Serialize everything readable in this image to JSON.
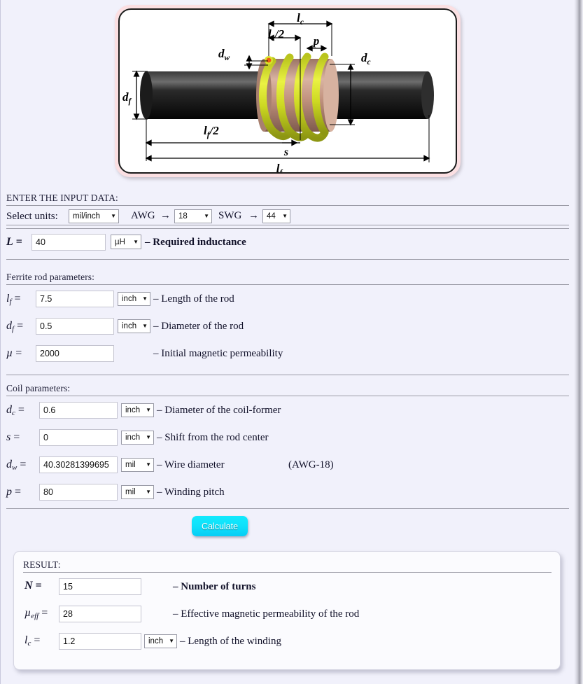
{
  "diagram": {
    "alt": "Ferrite rod inductor cross-section diagram",
    "labels": {
      "lc": "l",
      "lc_sub": "c",
      "lc_half": "l",
      "lc_half_sub": "c",
      "lc_half_suffix": "/2",
      "p": "p",
      "dc": "d",
      "dc_sub": "c",
      "dw": "d",
      "dw_sub": "w",
      "df": "d",
      "df_sub": "f",
      "lf_half": "l",
      "lf_half_sub": "f",
      "lf_half_suffix": "/2",
      "s": "s",
      "lf": "l",
      "lf_sub": "f"
    }
  },
  "header": {
    "enter_input": "ENTER THE INPUT DATA:"
  },
  "units_row": {
    "select_units_label": "Select units:",
    "units_value": "mil/inch",
    "awg_label": "AWG",
    "awg_arrow": "→",
    "awg_value": "18",
    "swg_label": "SWG",
    "swg_arrow": "→",
    "swg_value": "44"
  },
  "inductance": {
    "symbol": "L",
    "equals": "=",
    "value": "40",
    "unit": "µH",
    "desc": "– Required inductance"
  },
  "ferrite": {
    "title": "Ferrite rod parameters:",
    "rows": [
      {
        "symbol": "l",
        "sub": "f",
        "equals": "=",
        "value": "7.5",
        "unit": "inch",
        "desc": "– Length of the rod"
      },
      {
        "symbol": "d",
        "sub": "f",
        "equals": "=",
        "value": "0.5",
        "unit": "inch",
        "desc": "– Diameter of the rod"
      },
      {
        "symbol": "µ",
        "sub": "",
        "equals": "=",
        "value": "2000",
        "unit": "",
        "desc": "– Initial magnetic permeability"
      }
    ]
  },
  "coil": {
    "title": "Coil parameters:",
    "rows": [
      {
        "symbol": "d",
        "sub": "c",
        "equals": "=",
        "value": "0.6",
        "unit": "inch",
        "desc": "– Diameter of the coil-former",
        "note": ""
      },
      {
        "symbol": "s",
        "sub": "",
        "equals": "=",
        "value": "0",
        "unit": "inch",
        "desc": "– Shift from the rod center",
        "note": ""
      },
      {
        "symbol": "d",
        "sub": "w",
        "equals": "=",
        "value": "40.30281399695",
        "unit": "mil",
        "desc": "– Wire diameter",
        "note": "(AWG-18)"
      },
      {
        "symbol": "p",
        "sub": "",
        "equals": "=",
        "value": "80",
        "unit": "mil",
        "desc": "– Winding pitch",
        "note": ""
      }
    ]
  },
  "calculate": {
    "label": "Calculate"
  },
  "result": {
    "title": "RESULT:",
    "rows": [
      {
        "symbol": "N",
        "sub": "",
        "equals": "=",
        "value": "15",
        "unit": "",
        "desc": "– Number of turns",
        "bold": true
      },
      {
        "symbol": "µ",
        "sub": "eff",
        "equals": "=",
        "value": "28",
        "unit": "",
        "desc": "– Effective magnetic permeability of the rod",
        "bold": false
      },
      {
        "symbol": "l",
        "sub": "c",
        "equals": "=",
        "value": "1.2",
        "unit": "inch",
        "desc": "– Length of the winding",
        "bold": false
      }
    ]
  },
  "colors": {
    "page_bg": "#f1f1fb",
    "accent_button": "#0fe2fb",
    "frame_pink": "#fbdfe2",
    "coil_yellow": "#d4e02a",
    "former_tan": "#c9a08f",
    "rod_black": "#101010"
  }
}
